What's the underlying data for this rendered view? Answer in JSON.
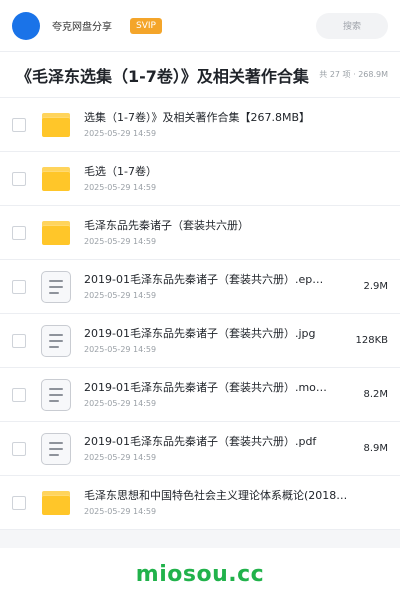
{
  "header": {
    "share_title": "夸克网盘分享",
    "badge": "SVIP",
    "search_placeholder": "搜索"
  },
  "page": {
    "title": "《毛泽东选集（1-7卷）》及相关著作合集",
    "meta": "共 27 项 · 268.9M"
  },
  "files": [
    {
      "type": "folder",
      "name": "选集（1-7卷）》及相关著作合集【267.8MB】",
      "date": "2025-05-29 14:59",
      "size": ""
    },
    {
      "type": "folder",
      "name": "毛选（1-7卷）",
      "date": "2025-05-29 14:59",
      "size": ""
    },
    {
      "type": "folder",
      "name": "毛泽东品先秦诸子（套装共六册）",
      "date": "2025-05-29 14:59",
      "size": ""
    },
    {
      "type": "doc",
      "name": "2019-01毛泽东品先秦诸子（套装共六册）.ep…",
      "date": "2025-05-29 14:59",
      "size": "2.9M"
    },
    {
      "type": "doc",
      "name": "2019-01毛泽东品先秦诸子（套装共六册）.jpg",
      "date": "2025-05-29 14:59",
      "size": "128KB"
    },
    {
      "type": "doc",
      "name": "2019-01毛泽东品先秦诸子（套装共六册）.mo…",
      "date": "2025-05-29 14:59",
      "size": "8.2M"
    },
    {
      "type": "doc",
      "name": "2019-01毛泽东品先秦诸子（套装共六册）.pdf",
      "date": "2025-05-29 14:59",
      "size": "8.9M"
    },
    {
      "type": "folder",
      "name": "毛泽东思想和中国特色社会主义理论体系概论(2018…",
      "date": "2025-05-29 14:59",
      "size": ""
    }
  ],
  "footer": {
    "brand": "miosou.cc"
  },
  "colors": {
    "accent": "#1a73e8",
    "badge": "#f4a52a",
    "folder": "#ffc629",
    "brand": "#21b24b"
  }
}
